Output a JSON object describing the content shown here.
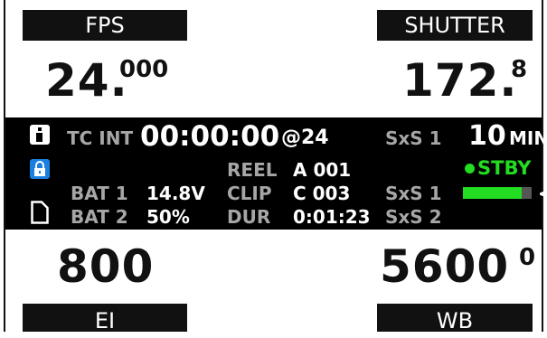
{
  "fps": {
    "label": "FPS",
    "value_main": "24.",
    "value_sup": "000"
  },
  "shutter": {
    "label": "SHUTTER",
    "value_main": "172.",
    "value_sup": "8"
  },
  "ei": {
    "label": "EI",
    "value": "800"
  },
  "wb": {
    "label": "WB",
    "value_main": "5600",
    "value_sup": "0"
  },
  "status": {
    "tc_label": "TC INT",
    "timecode": "00:00:00",
    "tc_rate": "@24",
    "media_label_1": "SxS 1",
    "remaining": "10",
    "remaining_unit": "MIN",
    "reel_label": "REEL",
    "reel_value": "A 001",
    "rec_state": "STBY",
    "bat1_label": "BAT 1",
    "bat1_value": "14.8V",
    "clip_label": "CLIP",
    "clip_value": "C 003",
    "media_label_2": "SxS 1",
    "bat2_label": "BAT 2",
    "bat2_value": "50%",
    "dur_label": "DUR",
    "dur_value": "0:01:23",
    "media_label_3": "SxS 2",
    "media_arrow": "<",
    "media_fill_fraction": 0.85,
    "icons": [
      "info-icon",
      "lock-icon",
      "document-icon"
    ],
    "colors": {
      "accent": "#1a7fe0",
      "rec_ok": "#22dd22"
    }
  }
}
